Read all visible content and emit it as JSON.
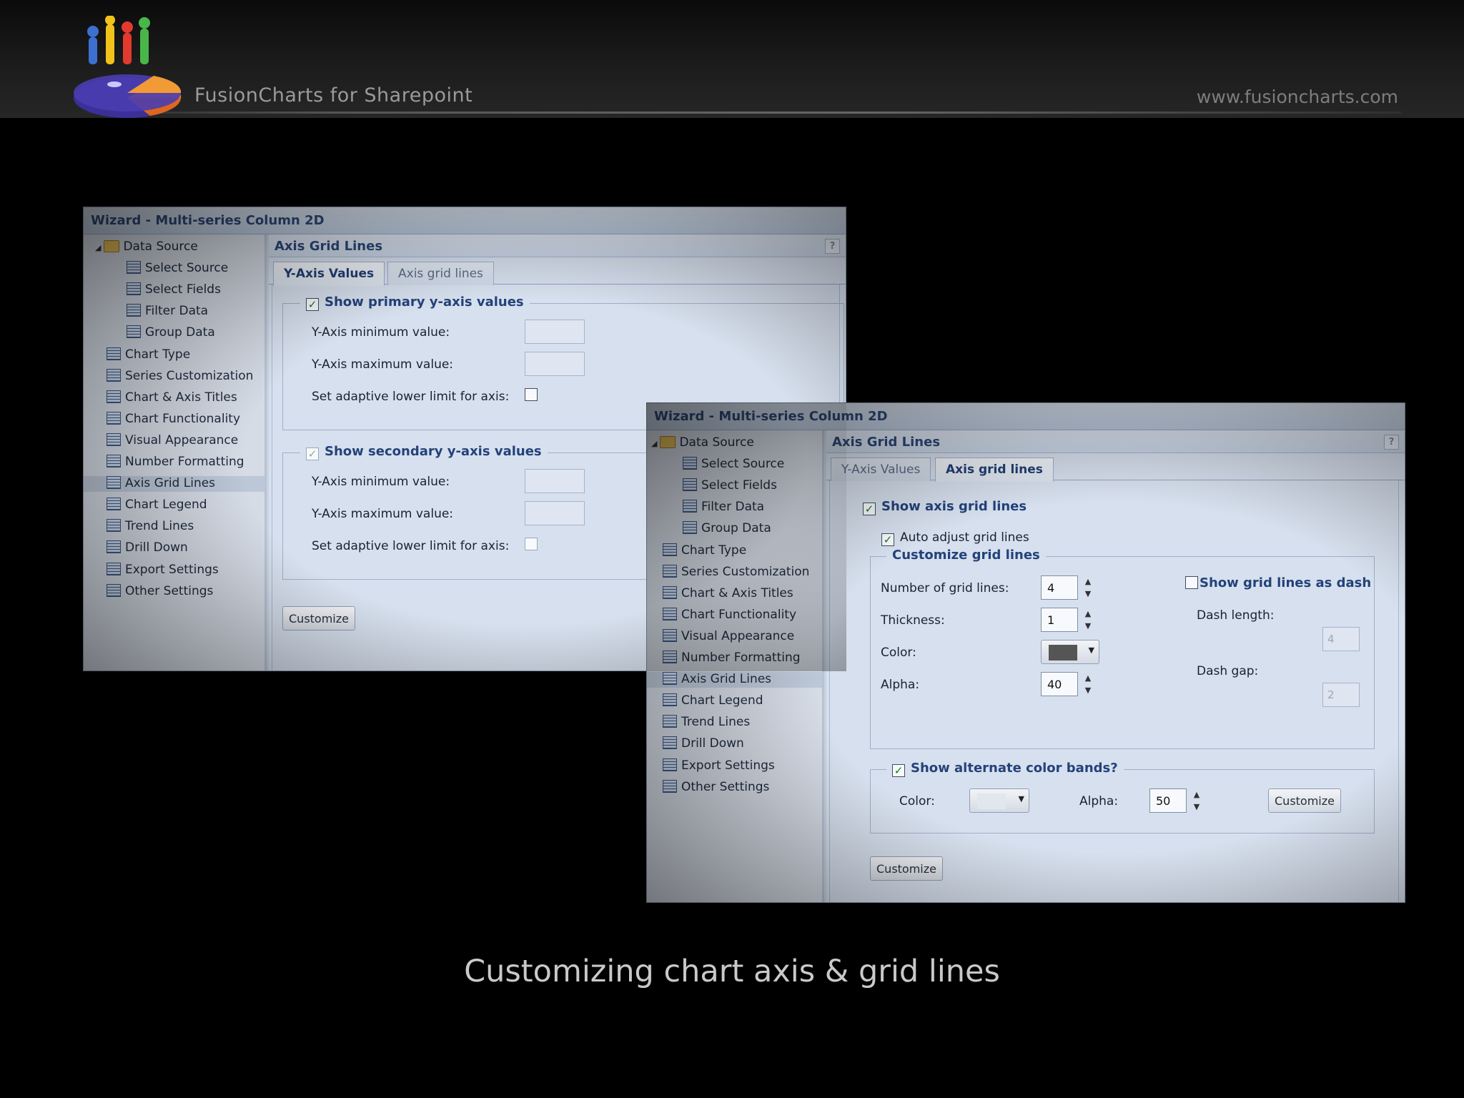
{
  "header": {
    "brand": "FusionCharts for Sharepoint",
    "site": "www.fusioncharts.com"
  },
  "caption": "Customizing chart axis & grid lines",
  "nav_items": [
    {
      "label": "Data Source",
      "level": 0
    },
    {
      "label": "Select Source",
      "level": 1
    },
    {
      "label": "Select Fields",
      "level": 1
    },
    {
      "label": "Filter Data",
      "level": 1
    },
    {
      "label": "Group Data",
      "level": 1
    },
    {
      "label": "Chart Type",
      "level": 0
    },
    {
      "label": "Series Customization",
      "level": 0
    },
    {
      "label": "Chart & Axis Titles",
      "level": 0
    },
    {
      "label": "Chart Functionality",
      "level": 0
    },
    {
      "label": "Visual Appearance",
      "level": 0
    },
    {
      "label": "Number Formatting",
      "level": 0
    },
    {
      "label": "Axis Grid Lines",
      "level": 0,
      "selected": true
    },
    {
      "label": "Chart Legend",
      "level": 0
    },
    {
      "label": "Trend Lines",
      "level": 0
    },
    {
      "label": "Drill Down",
      "level": 0
    },
    {
      "label": "Export Settings",
      "level": 0
    },
    {
      "label": "Other Settings",
      "level": 0
    }
  ],
  "wizard1": {
    "title": "Wizard - Multi-series Column 2D",
    "panel_title": "Axis Grid Lines",
    "help": "?",
    "tabs": [
      "Y-Axis Values",
      "Axis grid lines"
    ],
    "active_tab": "Y-Axis Values",
    "primary": {
      "legend": "Show primary y-axis values",
      "checked": true,
      "min_label": "Y-Axis minimum value:",
      "max_label": "Y-Axis maximum value:",
      "adaptive_label": "Set adaptive lower limit for axis:",
      "adaptive_checked": false
    },
    "secondary": {
      "legend": "Show secondary y-axis values",
      "checked": true,
      "min_label": "Y-Axis minimum value:",
      "max_label": "Y-Axis maximum value:",
      "adaptive_label": "Set adaptive lower limit for axis:",
      "adaptive_checked": false
    },
    "customize_label": "Customize"
  },
  "wizard2": {
    "title": "Wizard - Multi-series Column 2D",
    "panel_title": "Axis Grid Lines",
    "help": "?",
    "tabs": [
      "Y-Axis Values",
      "Axis grid lines"
    ],
    "active_tab": "Axis grid lines",
    "show_grid_label": "Show axis grid lines",
    "auto_adjust_label": "Auto adjust grid lines",
    "customize_group": "Customize grid lines",
    "num_lines_label": "Number of grid lines:",
    "num_lines_value": "4",
    "thickness_label": "Thickness:",
    "thickness_value": "1",
    "color_label": "Color:",
    "grid_color": "#555555",
    "alpha_label": "Alpha:",
    "alpha_value": "40",
    "dash_label": "Show grid lines as dash",
    "dash_length_label": "Dash length:",
    "dash_length_value": "4",
    "dash_gap_label": "Dash gap:",
    "dash_gap_value": "2",
    "bands_legend": "Show alternate color bands?",
    "bands_color_label": "Color:",
    "bands_alpha_label": "Alpha:",
    "bands_alpha_value": "50",
    "bands_customize_label": "Customize",
    "customize_label": "Customize"
  }
}
